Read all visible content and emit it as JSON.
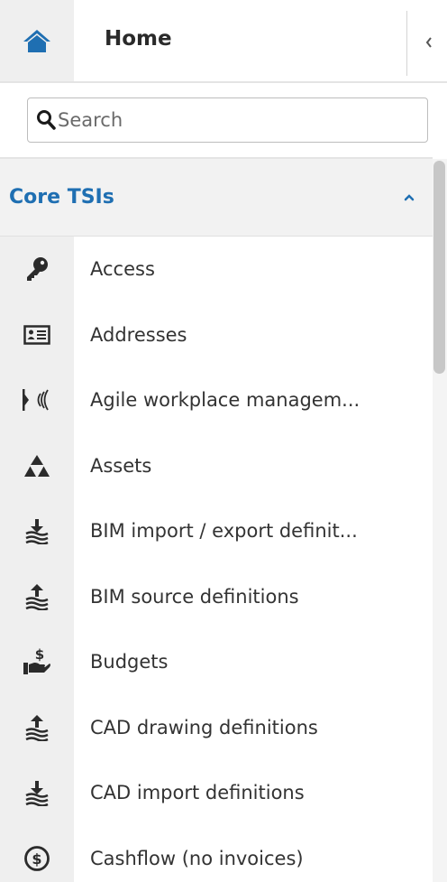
{
  "header": {
    "title": "Home",
    "home_icon": "home-icon",
    "collapse_icon": "chevron-left-icon"
  },
  "search": {
    "placeholder": "Search",
    "value": ""
  },
  "section": {
    "title": "Core TSIs",
    "expanded": true,
    "chevron_icon": "chevron-up-icon"
  },
  "items": [
    {
      "label": "Access",
      "icon": "key-icon"
    },
    {
      "label": "Addresses",
      "icon": "address-card-icon"
    },
    {
      "label": "Agile workplace managem...",
      "icon": "wireless-sensor-icon"
    },
    {
      "label": "Assets",
      "icon": "assets-triangle-icon"
    },
    {
      "label": "BIM import / export definit...",
      "icon": "layers-import-icon"
    },
    {
      "label": "BIM source definitions",
      "icon": "layers-source-icon"
    },
    {
      "label": "Budgets",
      "icon": "hand-dollar-icon"
    },
    {
      "label": "CAD drawing definitions",
      "icon": "layers-source-icon"
    },
    {
      "label": "CAD import definitions",
      "icon": "layers-import-icon"
    },
    {
      "label": "Cashflow (no invoices)",
      "icon": "dollar-circle-icon"
    }
  ],
  "colors": {
    "accent": "#1f6fb2",
    "icon_dark": "#2b2b2b",
    "icon_cell_bg": "#efefef"
  }
}
